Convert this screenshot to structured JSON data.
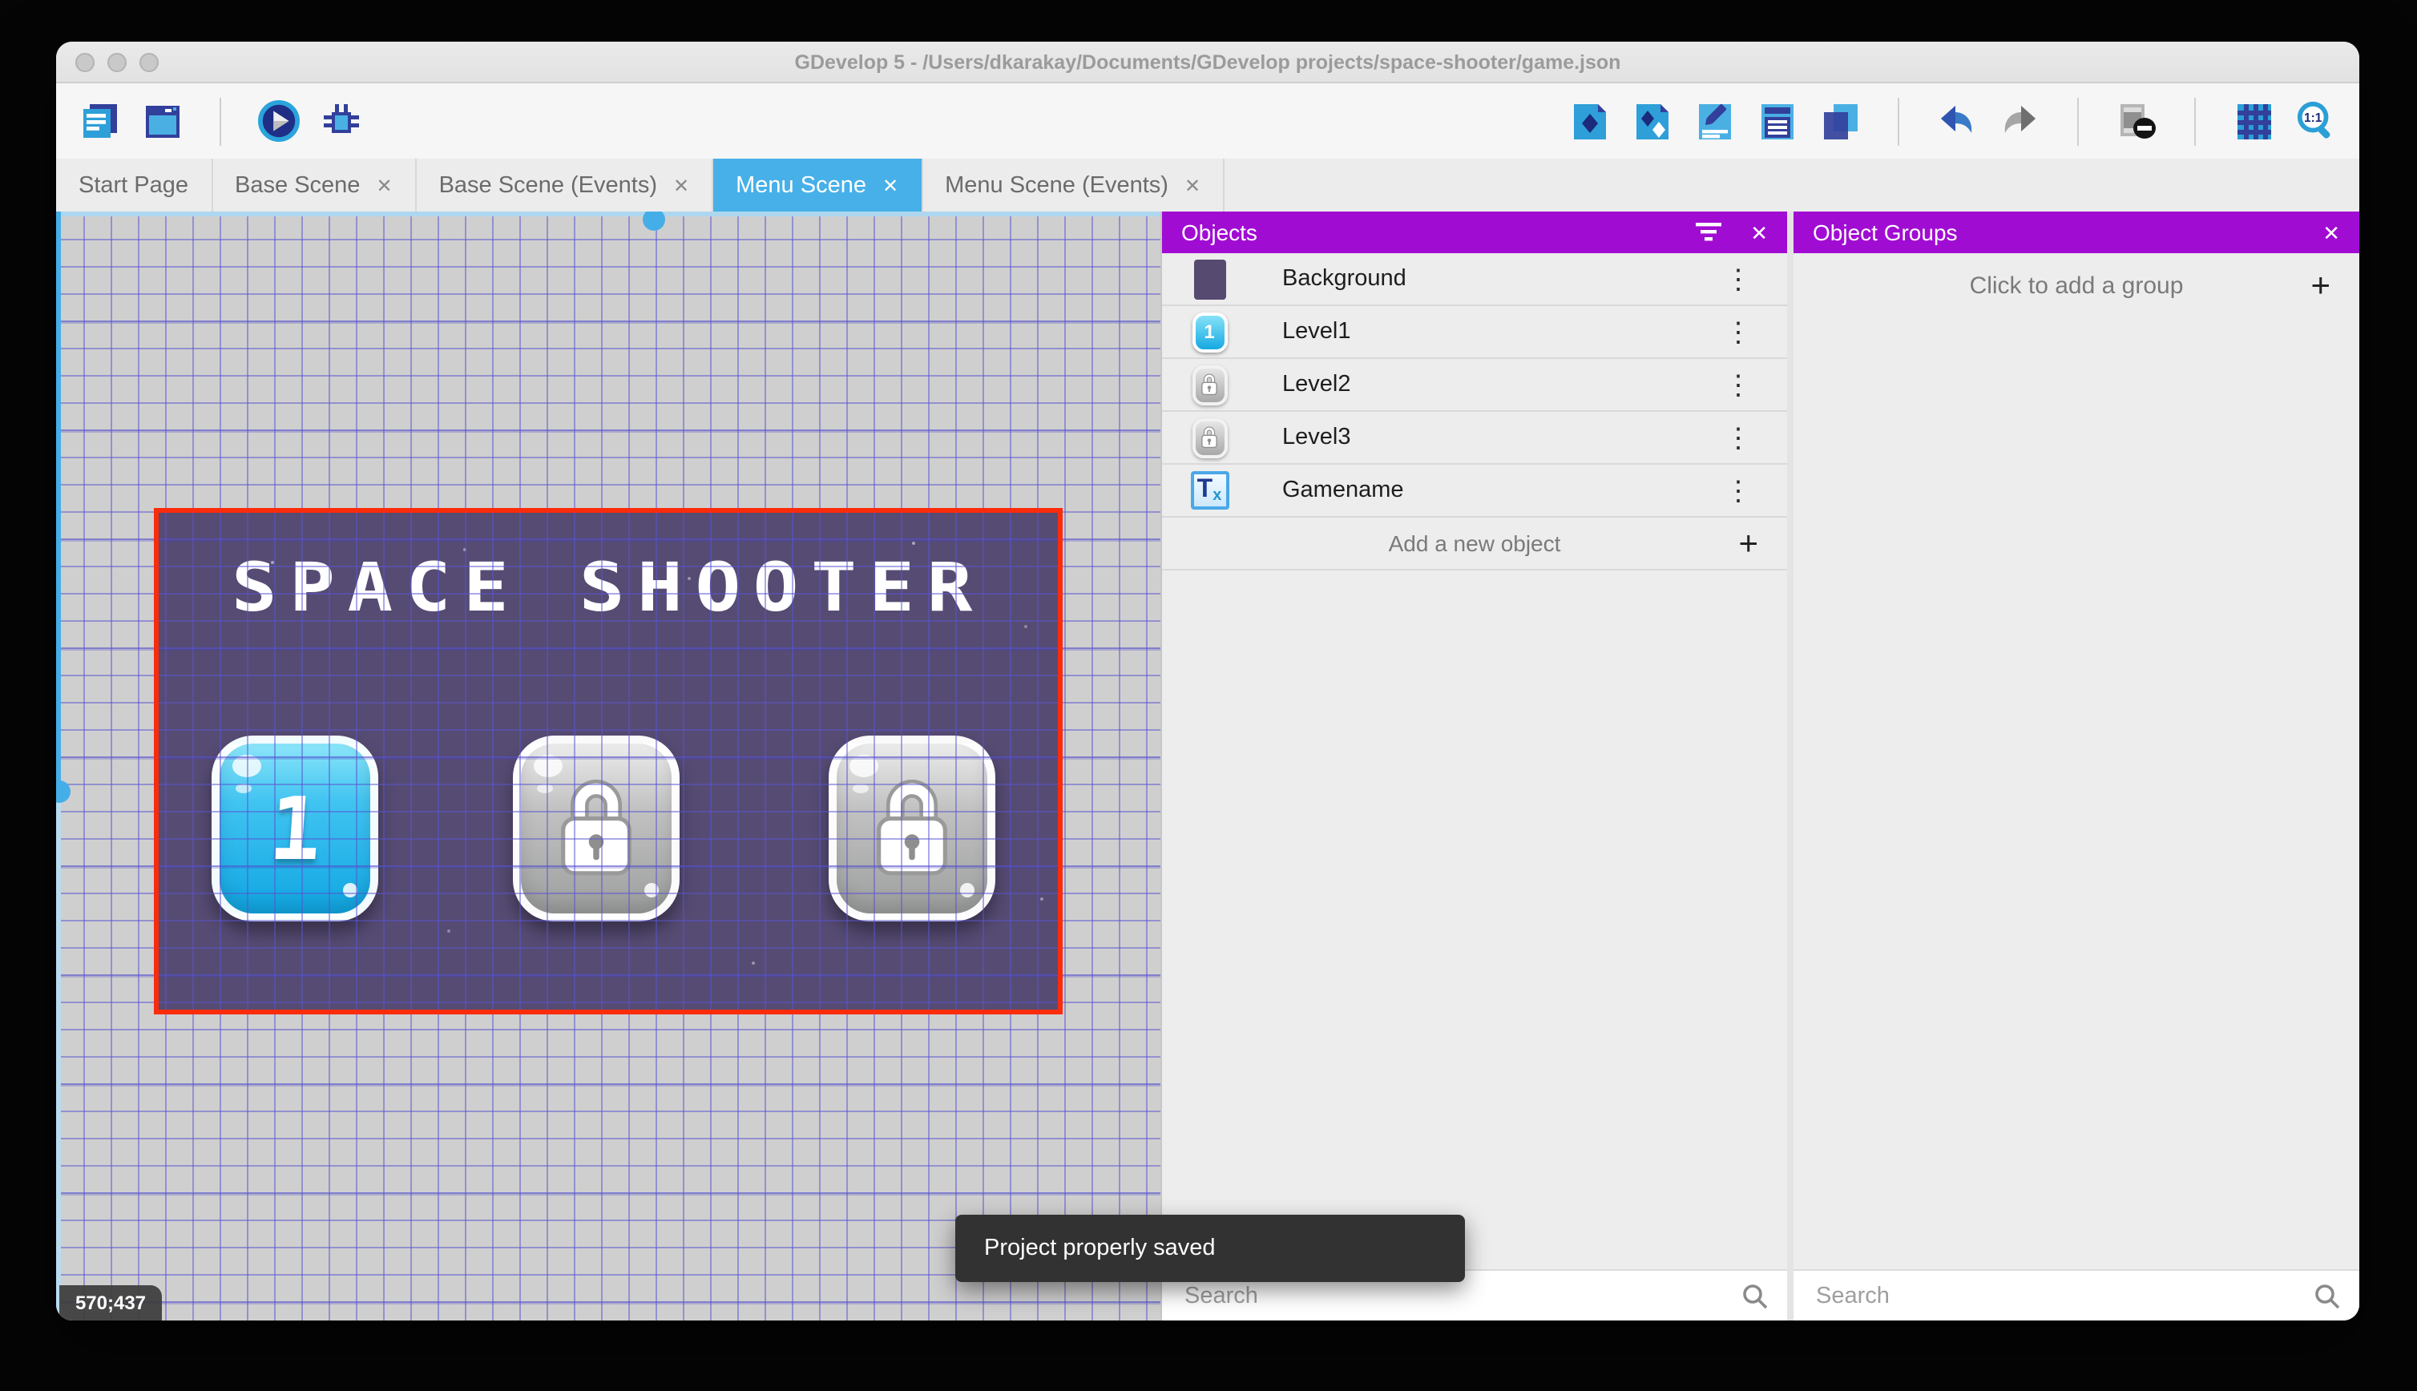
{
  "window": {
    "title": "GDevelop 5 - /Users/dkarakay/Documents/GDevelop projects/space-shooter/game.json"
  },
  "toolbar": {
    "left_icons": [
      "project-manager-icon",
      "start-page-icon",
      "play-icon",
      "debug-icon"
    ],
    "right_icons": [
      "add-instance-icon",
      "object-groups-icon",
      "properties-icon",
      "instances-list-icon",
      "layers-icon",
      "undo-icon",
      "redo-icon",
      "delete-instances-icon",
      "grid-icon",
      "zoom-1to1-icon"
    ]
  },
  "tabs": [
    {
      "label": "Start Page",
      "active": false,
      "closable": false
    },
    {
      "label": "Base Scene",
      "active": false,
      "closable": true
    },
    {
      "label": "Base Scene (Events)",
      "active": false,
      "closable": true
    },
    {
      "label": "Menu Scene",
      "active": true,
      "closable": true
    },
    {
      "label": "Menu Scene (Events)",
      "active": false,
      "closable": true
    }
  ],
  "canvas": {
    "coordinates_badge": "570;437",
    "scene": {
      "title": "SPACE SHOOTER",
      "background_color": "#564b73",
      "border_color": "#f92c0c",
      "buttons": [
        {
          "name": "level1",
          "label": "1",
          "state": "unlocked"
        },
        {
          "name": "level2",
          "label": "",
          "state": "locked"
        },
        {
          "name": "level3",
          "label": "",
          "state": "locked"
        }
      ]
    }
  },
  "objects_panel": {
    "title": "Objects",
    "items": [
      {
        "label": "Background",
        "icon": "background-swatch"
      },
      {
        "label": "Level1",
        "icon": "level-button-unlocked"
      },
      {
        "label": "Level2",
        "icon": "level-button-locked"
      },
      {
        "label": "Level3",
        "icon": "level-button-locked"
      },
      {
        "label": "Gamename",
        "icon": "text-object"
      }
    ],
    "add_label": "Add a new object",
    "search_placeholder": "Search"
  },
  "object_groups_panel": {
    "title": "Object Groups",
    "empty_label": "Click to add a group",
    "search_placeholder": "Search"
  },
  "toast": {
    "message": "Project properly saved"
  },
  "colors": {
    "panel_header": "#a10cd3",
    "active_tab": "#47b0e8",
    "scene_background": "#564b73",
    "scene_border": "#f92c0c",
    "toast_background": "#323232"
  }
}
